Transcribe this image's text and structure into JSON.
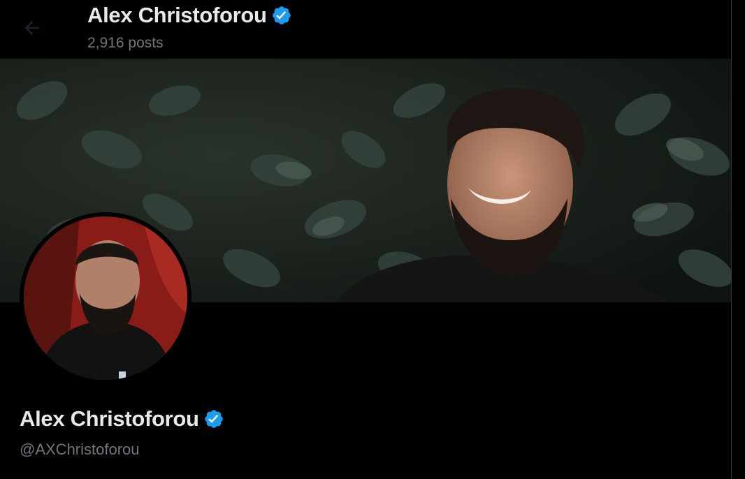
{
  "header": {
    "title": "Alex Christoforou",
    "posts_count": "2,916 posts"
  },
  "profile": {
    "display_name": "Alex Christoforou",
    "handle": "@AXChristoforou",
    "verified": true
  },
  "colors": {
    "background": "#000000",
    "primary_text": "#e7e9ea",
    "secondary_text": "#71767b",
    "verified_blue": "#1d9bf0",
    "divider": "#2f3336"
  },
  "icons": {
    "back": "arrow-left-icon",
    "verified": "verified-badge-icon"
  }
}
